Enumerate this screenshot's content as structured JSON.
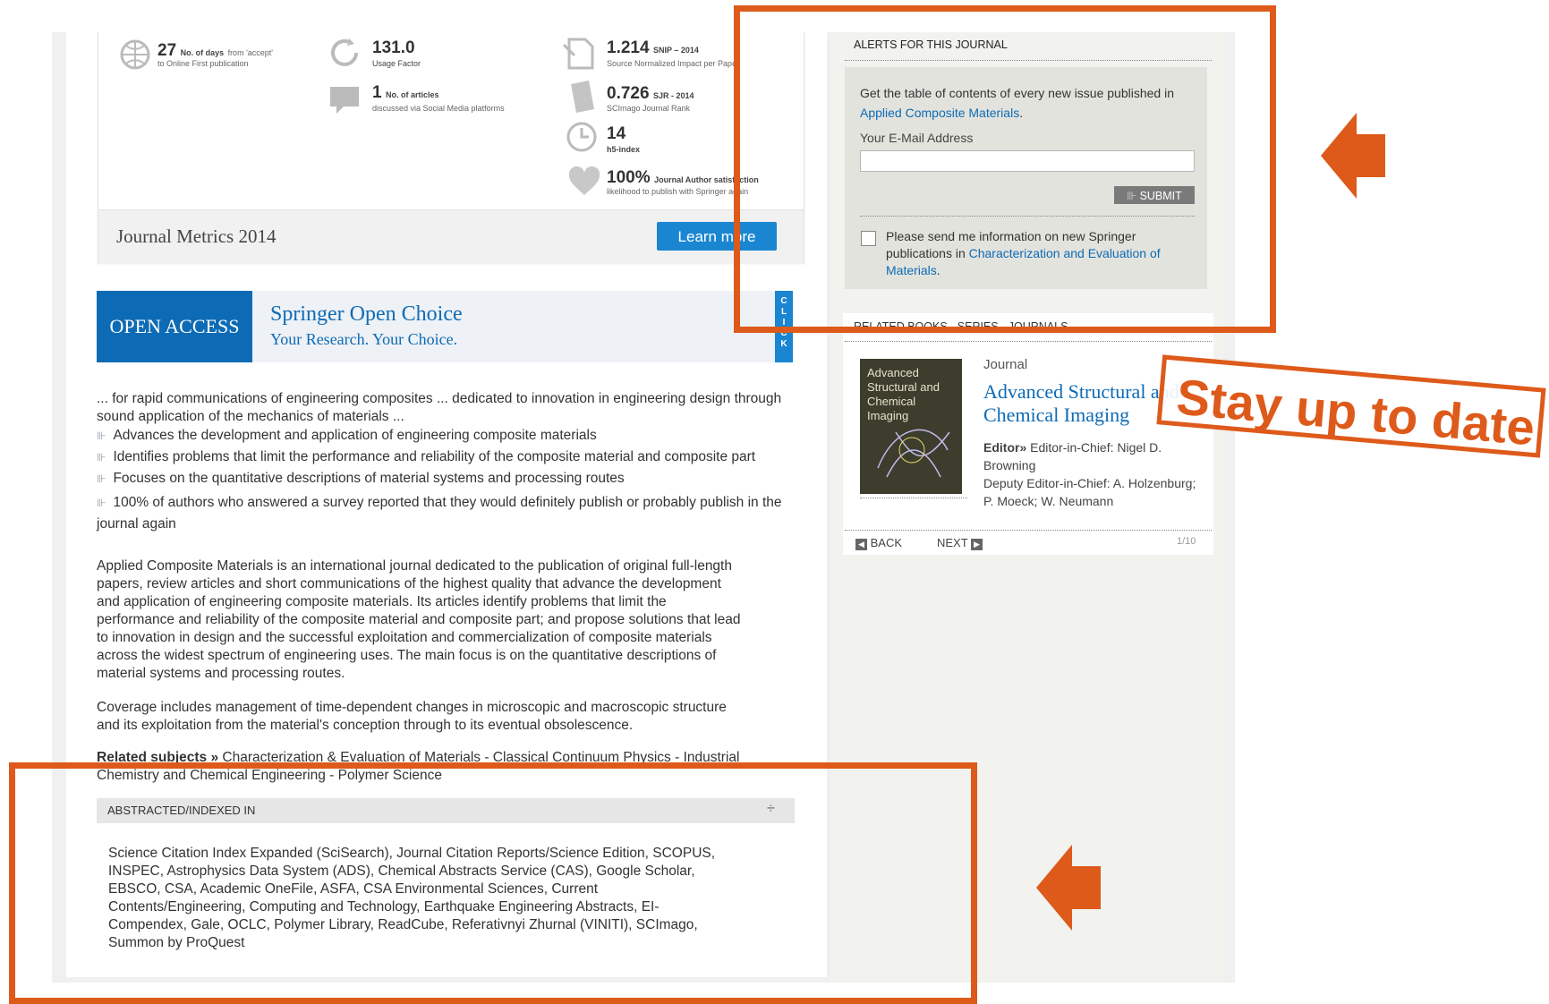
{
  "metrics": {
    "days": {
      "value": "27",
      "label": "No. of days",
      "label_small": "from 'accept'",
      "sub": "to Online First publication"
    },
    "usage": {
      "value": "131.0",
      "label": "Usage Factor"
    },
    "social": {
      "value": "1",
      "label": "No. of articles",
      "sub": "discussed via Social Media platforms"
    },
    "snip": {
      "value": "1.214",
      "label": "SNIP – 2014",
      "sub": "Source Normalized Impact per Paper"
    },
    "sjr": {
      "value": "0.726",
      "label": "SJR - 2014",
      "sub": "SCImago Journal Rank"
    },
    "h5": {
      "value": "14",
      "label": "h5-index"
    },
    "satisfaction": {
      "value": "100%",
      "label": "Journal Author satisfaction",
      "sub": "likelihood to publish with Springer again"
    },
    "footer_title": "Journal Metrics 2014",
    "learn_more": "Learn more"
  },
  "open_access": {
    "badge": "OPEN ACCESS",
    "title": "Springer Open Choice",
    "subtitle": "Your Research. Your Choice.",
    "click": [
      "C",
      "L",
      "I",
      "C",
      "K"
    ]
  },
  "intro": "... for rapid communications of engineering composites ... dedicated to innovation in engineering design through sound application of the mechanics of materials ...",
  "bullets": [
    "Advances the development and application of engineering composite materials",
    "Identifies problems that limit the performance and reliability of the composite material and composite part",
    "Focuses on the quantitative descriptions of material systems and processing routes",
    "100% of authors who answered a survey reported that they would definitely publish or probably publish in the journal again"
  ],
  "description": "Applied Composite Materials is an international journal dedicated to the publication of original full-length papers, review articles and short communications of the highest quality that advance the development and application of engineering composite materials. Its articles identify problems that limit the performance and reliability of the composite material and composite part; and propose solutions that lead to innovation in design and the successful exploitation and commercialization of composite materials across the widest spectrum of engineering uses. The main focus is on the quantitative descriptions of material systems and processing routes.",
  "coverage": "Coverage includes management of time-dependent changes in microscopic and macroscopic structure and its exploitation from the material's conception through to its eventual obsolescence.",
  "related_subjects": {
    "label": "Related subjects »",
    "items": "Characterization & Evaluation of Materials - Classical Continuum Physics - Industrial Chemistry and Chemical Engineering - Polymer Science"
  },
  "abstracted": {
    "title": "ABSTRACTED/INDEXED IN",
    "toggle": "÷",
    "text": "Science Citation Index Expanded (SciSearch), Journal Citation Reports/Science Edition, SCOPUS, INSPEC, Astrophysics Data System (ADS), Chemical Abstracts Service (CAS), Google Scholar, EBSCO, CSA, Academic OneFile, ASFA, CSA Environmental Sciences, Current Contents/Engineering, Computing and Technology, Earthquake Engineering Abstracts, EI-Compendex, Gale, OCLC, Polymer Library, ReadCube, Referativnyi Zhurnal (VINITI), SCImago, Summon by ProQuest"
  },
  "alerts": {
    "heading": "ALERTS FOR THIS JOURNAL",
    "text": "Get the table of contents of every new issue published in",
    "journal_link": "Applied Composite Materials",
    "email_label": "Your E-Mail Address",
    "email_value": "",
    "submit": "SUBMIT",
    "checkbox_text": "Please send me information on new Springer publications in",
    "checkbox_link": "Characterization and Evaluation of Materials"
  },
  "related": {
    "tabs": "RELATED BOOKS - SERIES - JOURNALS",
    "cover_title": "Advanced Structural and Chemical Imaging",
    "type": "Journal",
    "title": "Advanced Structural and Chemical Imaging",
    "editor_label": "Editor»",
    "editor_text": "Editor-in-Chief: Nigel D. Browning",
    "deputy_text": "Deputy Editor-in-Chief: A. Holzenburg; P. Moeck; W. Neumann",
    "back": "BACK",
    "next": "NEXT",
    "page": "1/10"
  },
  "annotation": {
    "stay_up_to_date": "Stay up to date",
    "color": "#de5a1a"
  }
}
